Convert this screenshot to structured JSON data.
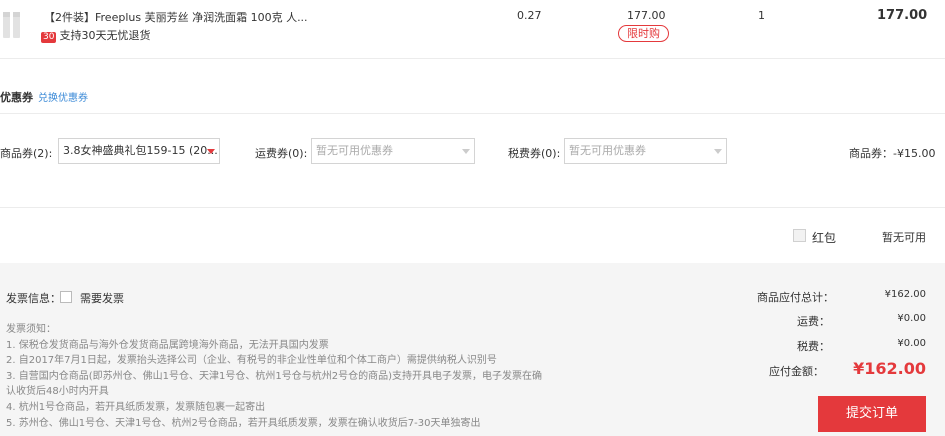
{
  "product": {
    "name": "【2件装】Freeplus 芙丽芳丝 净润洗面霜 100克 人...",
    "return_badge": "30",
    "return_text": "支持30天无忧退货",
    "tax": "0.27",
    "price": "177.00",
    "limit_tag": "限时购",
    "qty": "1",
    "subtotal": "177.00"
  },
  "coupons": {
    "title": "优惠券",
    "exchange_link": "兑换优惠券",
    "goods_label": "商品券(2):",
    "goods_value": "3.8女神盛典礼包159-15 (20...",
    "shipping_label": "运费券(0):",
    "shipping_value": "暂无可用优惠券",
    "tax_label": "税费券(0):",
    "tax_value": "暂无可用优惠券",
    "summary": "商品券：-¥15.00"
  },
  "red_packet": {
    "label": "红包",
    "status": "暂无可用"
  },
  "invoice": {
    "label": "发票信息：",
    "need": "需要发票",
    "notes": [
      "发票须知：",
      "1. 保税仓发货商品与海外仓发货商品属跨境海外商品，无法开具国内发票",
      "2. 自2017年7月1日起，发票抬头选择公司（企业、有税号的非企业性单位和个体工商户）需提供纳税人识别号",
      "3. 自营国内仓商品(即苏州仓、佛山1号仓、天津1号仓、杭州1号仓与杭州2号仓的商品)支持开具电子发票，电子发票在确",
      "认收货后48小时内开具",
      "4. 杭州1号仓商品，若开具纸质发票，发票随包裹一起寄出",
      "5. 苏州仓、佛山1号仓、天津1号仓、杭州2号仓商品，若开具纸质发票，发票在确认收货后7-30天单独寄出"
    ]
  },
  "summary": {
    "goods_total_label": "商品应付总计：",
    "goods_total": "¥162.00",
    "shipping_label": "运费：",
    "shipping": "¥0.00",
    "tax_label": "税费：",
    "tax": "¥0.00",
    "pay_label": "应付金额：",
    "pay": "¥162.00",
    "submit": "提交订单"
  },
  "colors": {
    "accent": "#e4393c",
    "link": "#3b8ad7"
  }
}
